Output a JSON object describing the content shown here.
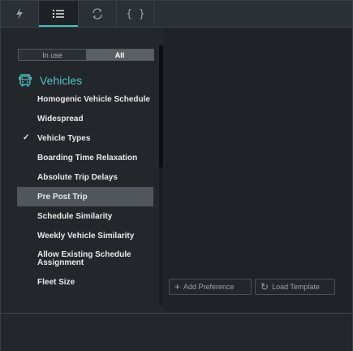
{
  "tabs": [
    {
      "name": "lightning",
      "icon": "lightning-icon"
    },
    {
      "name": "list",
      "icon": "list-icon",
      "active": true
    },
    {
      "name": "cycle",
      "icon": "cycle-icon"
    },
    {
      "name": "code",
      "icon": "braces-icon",
      "label": "{ }"
    }
  ],
  "filter": {
    "in_use": "In use",
    "all": "All",
    "selected": "All"
  },
  "section": {
    "title": "Vehicles",
    "icon": "bus-icon"
  },
  "items": [
    {
      "label": "Homogenic Vehicle Schedule"
    },
    {
      "label": "Widespread"
    },
    {
      "label": "Vehicle Types",
      "checked": true
    },
    {
      "label": "Boarding Time Relaxation"
    },
    {
      "label": "Absolute Trip Delays"
    },
    {
      "label": "Pre Post Trip",
      "selected": true
    },
    {
      "label": "Schedule Similarity"
    },
    {
      "label": "Weekly Vehicle Similarity"
    },
    {
      "label": "Allow Existing Schedule Assignment"
    },
    {
      "label": "Fleet Size"
    }
  ],
  "actions": {
    "add_preference": "Add Preference",
    "load_template": "Load Template"
  },
  "colors": {
    "accent": "#3ec3c0",
    "section_title": "#4fc4c0"
  }
}
